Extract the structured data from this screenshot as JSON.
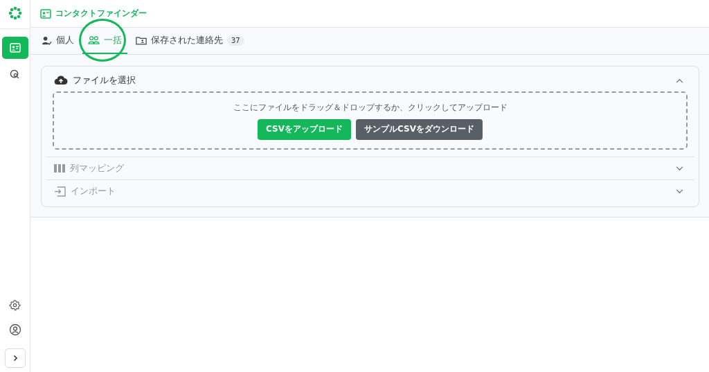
{
  "sidebar": {
    "items": [
      {
        "kind": "contact",
        "selected": true
      },
      {
        "kind": "search",
        "selected": false
      }
    ]
  },
  "app": {
    "title": "コンタクトファインダー"
  },
  "tabs": [
    {
      "kind": "person",
      "label": "個人",
      "selected": false,
      "circled": false
    },
    {
      "kind": "group",
      "label": "一括",
      "selected": true,
      "circled": true
    },
    {
      "kind": "folder",
      "label": "保存された連絡先",
      "selected": false,
      "circled": false,
      "count": "37"
    }
  ],
  "sections": [
    {
      "kind": "upload",
      "title": "ファイルを選択",
      "expanded": true,
      "disabled": false,
      "dropzone": {
        "hint": "ここにファイルをドラッグ＆ドロップするか、クリックしてアップロード",
        "buttons": [
          {
            "kind": "primary",
            "label": "CSVをアップロード"
          },
          {
            "kind": "secondary",
            "label": "サンプルCSVをダウンロード"
          }
        ]
      }
    },
    {
      "kind": "columns",
      "title": "列マッピング",
      "expanded": false,
      "disabled": true
    },
    {
      "kind": "import",
      "title": "インポート",
      "expanded": false,
      "disabled": true
    }
  ]
}
